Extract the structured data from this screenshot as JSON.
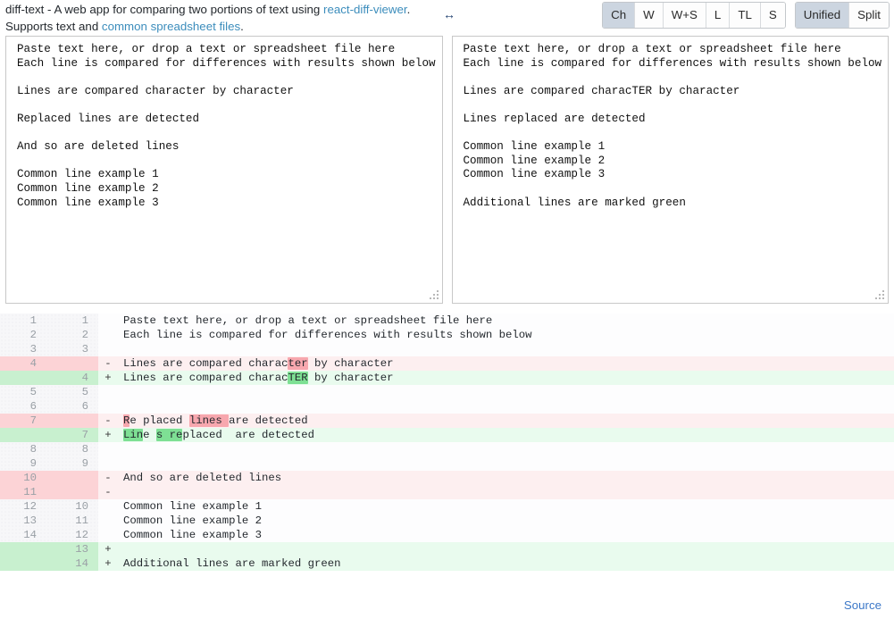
{
  "header": {
    "intro_prefix": "diff-text - A web app for comparing two portions of text using ",
    "link_react_diff_viewer": "react-diff-viewer",
    "intro_middle": ". Supports text and ",
    "link_spreadsheet": "common spreadsheet files",
    "intro_suffix": ".",
    "swap_icon": "swap-horizontal-icon",
    "swap_glyph": "↔"
  },
  "toolbar": {
    "compare_modes": [
      {
        "label": "Ch",
        "active": true
      },
      {
        "label": "W",
        "active": false
      },
      {
        "label": "W+S",
        "active": false
      },
      {
        "label": "L",
        "active": false
      },
      {
        "label": "TL",
        "active": false
      },
      {
        "label": "S",
        "active": false
      }
    ],
    "view_modes": [
      {
        "label": "Unified",
        "active": true
      },
      {
        "label": "Split",
        "active": false
      }
    ],
    "active_bg": "#ccd5e0"
  },
  "editors": {
    "left": {
      "placeholder": "Paste text here, or drop a text or spreadsheet file here",
      "value": "Paste text here, or drop a text or spreadsheet file here\nEach line is compared for differences with results shown below\n\nLines are compared character by character\n\nReplaced lines are detected\n\nAnd so are deleted lines\n\nCommon line example 1\nCommon line example 2\nCommon line example 3"
    },
    "right": {
      "placeholder": "Paste text here, or drop a text or spreadsheet file here",
      "value": "Paste text here, or drop a text or spreadsheet file here\nEach line is compared for differences with results shown below\n\nLines are compared characTER by character\n\nLines replaced are detected\n\nCommon line example 1\nCommon line example 2\nCommon line example 3\n\nAdditional lines are marked green"
    }
  },
  "diff": {
    "rows": [
      {
        "type": "ctx",
        "left": "1",
        "right": "1",
        "marker": "",
        "parts": [
          {
            "t": "Paste text here, or drop a text or spreadsheet file here"
          }
        ]
      },
      {
        "type": "ctx",
        "left": "2",
        "right": "2",
        "marker": "",
        "parts": [
          {
            "t": "Each line is compared for differences with results shown below"
          }
        ]
      },
      {
        "type": "ctx",
        "left": "3",
        "right": "3",
        "marker": "",
        "parts": [
          {
            "t": ""
          }
        ]
      },
      {
        "type": "del",
        "left": "4",
        "right": "",
        "marker": "-",
        "parts": [
          {
            "t": "Lines are compared charac"
          },
          {
            "t": "ter",
            "hl": "del"
          },
          {
            "t": " by character"
          }
        ]
      },
      {
        "type": "add",
        "left": "",
        "right": "4",
        "marker": "+",
        "parts": [
          {
            "t": "Lines are compared charac"
          },
          {
            "t": "TER",
            "hl": "add"
          },
          {
            "t": " by character"
          }
        ]
      },
      {
        "type": "ctx",
        "left": "5",
        "right": "5",
        "marker": "",
        "parts": [
          {
            "t": ""
          }
        ]
      },
      {
        "type": "ctx",
        "left": "6",
        "right": "6",
        "marker": "",
        "parts": [
          {
            "t": ""
          }
        ]
      },
      {
        "type": "del",
        "left": "7",
        "right": "",
        "marker": "-",
        "parts": [
          {
            "t": "R",
            "hl": "del"
          },
          {
            "t": "e placed "
          },
          {
            "t": "lines ",
            "hl": "del"
          },
          {
            "t": "are detected"
          }
        ]
      },
      {
        "type": "add",
        "left": "",
        "right": "7",
        "marker": "+",
        "parts": [
          {
            "t": "Lin",
            "hl": "add"
          },
          {
            "t": "e "
          },
          {
            "t": "s re",
            "hl": "add"
          },
          {
            "t": "placed  are detected"
          }
        ]
      },
      {
        "type": "ctx",
        "left": "8",
        "right": "8",
        "marker": "",
        "parts": [
          {
            "t": ""
          }
        ]
      },
      {
        "type": "ctx",
        "left": "9",
        "right": "9",
        "marker": "",
        "parts": [
          {
            "t": ""
          }
        ]
      },
      {
        "type": "del",
        "left": "10",
        "right": "",
        "marker": "-",
        "parts": [
          {
            "t": "And so are deleted lines"
          }
        ]
      },
      {
        "type": "del",
        "left": "11",
        "right": "",
        "marker": "-",
        "parts": [
          {
            "t": ""
          }
        ]
      },
      {
        "type": "ctx",
        "left": "12",
        "right": "10",
        "marker": "",
        "parts": [
          {
            "t": "Common line example 1"
          }
        ]
      },
      {
        "type": "ctx",
        "left": "13",
        "right": "11",
        "marker": "",
        "parts": [
          {
            "t": "Common line example 2"
          }
        ]
      },
      {
        "type": "ctx",
        "left": "14",
        "right": "12",
        "marker": "",
        "parts": [
          {
            "t": "Common line example 3"
          }
        ]
      },
      {
        "type": "add",
        "left": "",
        "right": "13",
        "marker": "+",
        "parts": [
          {
            "t": ""
          }
        ]
      },
      {
        "type": "add",
        "left": "",
        "right": "14",
        "marker": "+",
        "parts": [
          {
            "t": "Additional lines are marked green"
          }
        ]
      }
    ]
  },
  "footer": {
    "source_label": "Source"
  }
}
